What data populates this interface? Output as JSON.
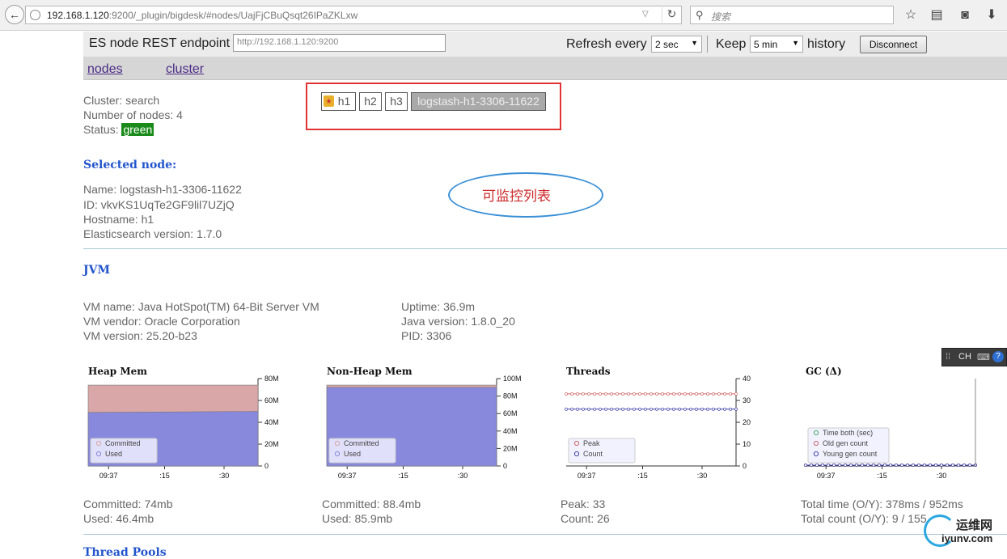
{
  "browser": {
    "url_host": "192.168.1.120",
    "url_rest": ":9200/_plugin/bigdesk/#nodes/UajFjCBuQsqt26IPaZKLxw",
    "search_placeholder": "搜索"
  },
  "header": {
    "endpoint_label": "ES node REST endpoint",
    "endpoint_value": "http://192.168.1.120:9200",
    "refresh_label": "Refresh every",
    "refresh_value": "2 sec",
    "keep_label": "Keep",
    "keep_value": "5 min",
    "history_label": "history",
    "disconnect_label": "Disconnect"
  },
  "nav": {
    "nodes": "nodes",
    "cluster": "cluster"
  },
  "cluster": {
    "cluster_line": "Cluster: search",
    "nodes_line": "Number of nodes: 4",
    "status_label": "Status:",
    "status_value": "green",
    "status_color": "#1a8a1a"
  },
  "node_buttons": [
    "h1",
    "h2",
    "h3",
    "logstash-h1-3306-11622"
  ],
  "annotation": {
    "text": "可监控列表",
    "ellipse_color": "#3a8fd6",
    "box_color": "#e03434"
  },
  "selected_node": {
    "title": "Selected node:",
    "name": "Name: logstash-h1-3306-11622",
    "id": "ID: vkvKS1UqTe2GF9lil7UZjQ",
    "hostname": "Hostname: h1",
    "version": "Elasticsearch version: 1.7.0"
  },
  "jvm": {
    "title": "JVM",
    "vm_name": "VM name: Java HotSpot(TM) 64-Bit Server VM",
    "vm_vendor": "VM vendor: Oracle Corporation",
    "vm_version": "VM version: 25.20-b23",
    "uptime": "Uptime: 36.9m",
    "java_version": "Java version: 1.8.0_20",
    "pid": "PID: 3306"
  },
  "charts": {
    "heap": {
      "title": "Heap Mem",
      "legend": [
        "Committed",
        "Used"
      ],
      "stat1": "Committed: 74mb",
      "stat2": "Used: 46.4mb"
    },
    "nonheap": {
      "title": "Non-Heap Mem",
      "legend": [
        "Committed",
        "Used"
      ],
      "stat1": "Committed: 88.4mb",
      "stat2": "Used: 85.9mb"
    },
    "threads": {
      "title": "Threads",
      "legend": [
        "Peak",
        "Count"
      ],
      "stat1": "Peak: 33",
      "stat2": "Count: 26"
    },
    "gc": {
      "title": "GC (Δ)",
      "legend": [
        "Time both (sec)",
        "Old gen count",
        "Young gen count"
      ],
      "stat1": "Total time (O/Y): 378ms / 952ms",
      "stat2": "Total count (O/Y): 9 / 155"
    }
  },
  "chart_data": [
    {
      "type": "area",
      "title": "Heap Mem",
      "categories": [
        "09:37",
        ":15",
        ":30"
      ],
      "yticks": [
        "0",
        "20M",
        "40M",
        "60M",
        "80M"
      ],
      "ylim": [
        0,
        80
      ],
      "series": [
        {
          "name": "Committed",
          "values": [
            74,
            74,
            74
          ],
          "color": "#d9a7a7"
        },
        {
          "name": "Used",
          "values": [
            49,
            49.5,
            50
          ],
          "color": "#8888dd"
        }
      ],
      "legend": "bottom-left"
    },
    {
      "type": "area",
      "title": "Non-Heap Mem",
      "categories": [
        "09:37",
        ":15",
        ":30"
      ],
      "yticks": [
        "0",
        "20M",
        "40M",
        "60M",
        "80M",
        "100M"
      ],
      "ylim": [
        0,
        100
      ],
      "series": [
        {
          "name": "Committed",
          "values": [
            92.5,
            92.5,
            92.5
          ],
          "color": "#d9a7a7"
        },
        {
          "name": "Used",
          "values": [
            90,
            90,
            90
          ],
          "color": "#8888dd"
        }
      ],
      "legend": "bottom-left"
    },
    {
      "type": "line",
      "title": "Threads",
      "categories": [
        "09:37",
        ":15",
        ":30"
      ],
      "yticks": [
        "0",
        "10",
        "20",
        "30",
        "40"
      ],
      "ylim": [
        0,
        40
      ],
      "series": [
        {
          "name": "Peak",
          "values": [
            33,
            33,
            33
          ],
          "color": "#cc6666"
        },
        {
          "name": "Count",
          "values": [
            26,
            26,
            26
          ],
          "color": "#4444aa"
        }
      ],
      "legend": "bottom-left"
    },
    {
      "type": "line",
      "title": "GC (Δ)",
      "categories": [
        "09:37",
        ":15",
        ":30"
      ],
      "series": [
        {
          "name": "Time both (sec)",
          "values": [
            0,
            0,
            0
          ],
          "color": "#44aa66"
        },
        {
          "name": "Old gen count",
          "values": [
            0,
            0,
            0
          ],
          "color": "#cc6666"
        },
        {
          "name": "Young gen count",
          "values": [
            0,
            0,
            0
          ],
          "color": "#4444aa"
        }
      ],
      "legend": "bottom-left"
    }
  ],
  "ime": {
    "text": "CH"
  },
  "watermark": {
    "cn": "运维网",
    "en": "iyunv.com"
  },
  "next_section": "Thread Pools"
}
